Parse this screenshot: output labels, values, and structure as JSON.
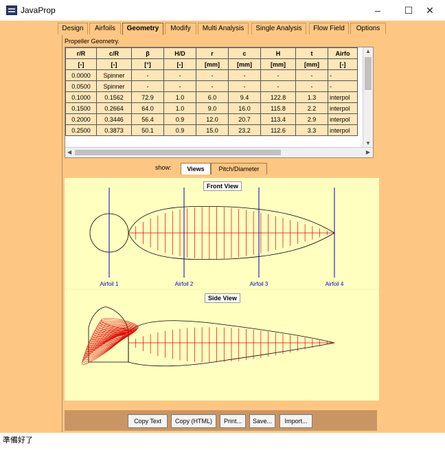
{
  "window": {
    "title": "JavaProp",
    "minimize": "–",
    "maximize": "☐",
    "close": "✕"
  },
  "tabs": [
    "Design",
    "Airfoils",
    "Geometry",
    "Modify",
    "Multi Analysis",
    "Single Analysis",
    "Flow Field",
    "Options"
  ],
  "active_tab": "Geometry",
  "panel_label": "Propeller Geometry.",
  "table": {
    "headers": [
      "r/R",
      "c/R",
      "β",
      "H/D",
      "r",
      "c",
      "H",
      "t",
      "Airfo"
    ],
    "units": [
      "[-]",
      "[-]",
      "[°]",
      "[-]",
      "[mm]",
      "[mm]",
      "[mm]",
      "[mm]",
      "[-]"
    ],
    "rows": [
      [
        "0.0000",
        "Spinner",
        "-",
        "-",
        "-",
        "-",
        "-",
        "-",
        "-"
      ],
      [
        "0.0500",
        "Spinner",
        "-",
        "-",
        "-",
        "-",
        "-",
        "-",
        "-"
      ],
      [
        "0.1000",
        "0.1562",
        "72.9",
        "1.0",
        "6.0",
        "9.4",
        "122.8",
        "1.3",
        "interpol"
      ],
      [
        "0.1500",
        "0.2664",
        "64.0",
        "1.0",
        "9.0",
        "16.0",
        "115.8",
        "2.2",
        "interpol"
      ],
      [
        "0.2000",
        "0.3446",
        "56.4",
        "0.9",
        "12.0",
        "20.7",
        "113.4",
        "2.9",
        "interpol"
      ],
      [
        "0.2500",
        "0.3873",
        "50.1",
        "0.9",
        "15.0",
        "23.2",
        "112.6",
        "3.3",
        "interpol"
      ]
    ]
  },
  "subtabs": {
    "show_label": "show:",
    "items": [
      "Views",
      "Pitch/Diameter"
    ],
    "active": "Views"
  },
  "views": {
    "front_title": "Front View",
    "side_title": "Side View",
    "airfoils": [
      "Airfoil 1",
      "Airfoil 2",
      "Airfoil 3",
      "Airfoil 4"
    ],
    "colors": {
      "outline": "#000000",
      "stations": "#e00000",
      "airfoil_lines": "#0000cc",
      "background": "#ffffc0"
    }
  },
  "buttons": [
    "Copy Text",
    "Copy (HTML)",
    "Print...",
    "Save...",
    "Import..."
  ],
  "status": "準備好了"
}
